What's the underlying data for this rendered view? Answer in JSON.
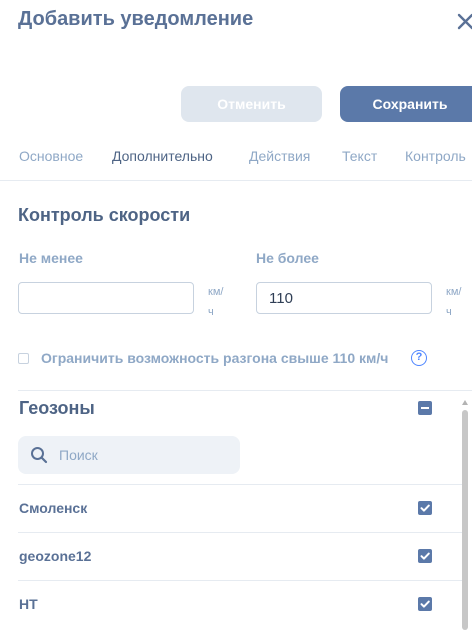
{
  "dialog": {
    "title": "Добавить уведомление",
    "cancel_label": "Отменить",
    "save_label": "Сохранить"
  },
  "tabs": [
    {
      "label": "Основное",
      "active": false
    },
    {
      "label": "Дополнительно",
      "active": true
    },
    {
      "label": "Действия",
      "active": false
    },
    {
      "label": "Текст",
      "active": false
    },
    {
      "label": "Контроль",
      "active": false
    }
  ],
  "speed_control": {
    "title": "Контроль скорости",
    "min_label": "Не менее",
    "min_value": "",
    "max_label": "Не более",
    "max_value": "110",
    "unit_line1": "км/",
    "unit_line2": "ч",
    "limit_acceleration_label": "Ограничить возможность разгона свыше 110 км/ч",
    "limit_acceleration_checked": false,
    "help_glyph": "?"
  },
  "geozones": {
    "title": "Геозоны",
    "search_placeholder": "Поиск",
    "items": [
      {
        "name": "Смоленск",
        "checked": true
      },
      {
        "name": "geozone12",
        "checked": true
      },
      {
        "name": "НТ",
        "checked": true
      }
    ]
  },
  "colors": {
    "primary": "#5b79a9",
    "text": "#5a7196",
    "muted": "#8fa8c6",
    "help": "#4f86ff"
  }
}
